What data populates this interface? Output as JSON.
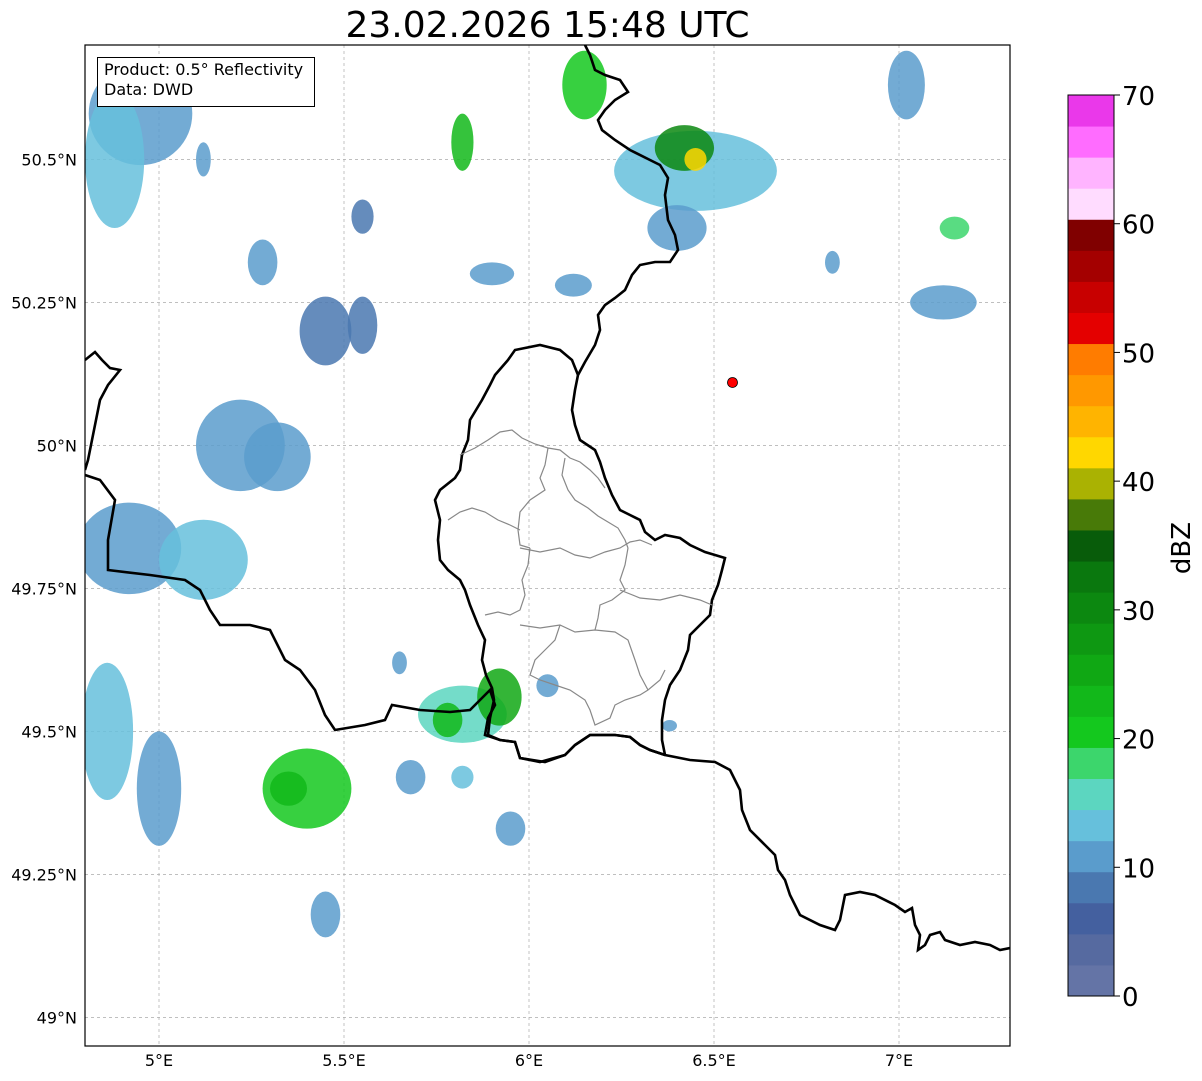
{
  "title": "23.02.2026 15:48 UTC",
  "info": {
    "product": "Product: 0.5° Reflectivity",
    "data": "Data: DWD"
  },
  "map": {
    "extent": {
      "lon": [
        4.8,
        7.3
      ],
      "lat": [
        48.95,
        50.7
      ]
    },
    "lon_ticks": [
      {
        "value": 5.0,
        "label": "5°E"
      },
      {
        "value": 5.5,
        "label": "5.5°E"
      },
      {
        "value": 6.0,
        "label": "6°E"
      },
      {
        "value": 6.5,
        "label": "6.5°E"
      },
      {
        "value": 7.0,
        "label": "7°E"
      }
    ],
    "lat_ticks": [
      {
        "value": 50.5,
        "label": "50.5°N"
      },
      {
        "value": 50.25,
        "label": "50.25°N"
      },
      {
        "value": 50.0,
        "label": "50°N"
      },
      {
        "value": 49.75,
        "label": "49.75°N"
      },
      {
        "value": 49.5,
        "label": "49.5°N"
      },
      {
        "value": 49.25,
        "label": "49.25°N"
      },
      {
        "value": 49.0,
        "label": "49°N"
      }
    ],
    "radar_site": {
      "lon": 6.55,
      "lat": 50.11,
      "color": "#ff0000"
    },
    "echo_cells": [
      {
        "lon": 4.95,
        "lat": 50.58,
        "rlon": 0.14,
        "rlat": 0.09,
        "dbz": 12
      },
      {
        "lon": 4.88,
        "lat": 50.5,
        "rlon": 0.08,
        "rlat": 0.12,
        "dbz": 14
      },
      {
        "lon": 5.22,
        "lat": 50.0,
        "rlon": 0.12,
        "rlat": 0.08,
        "dbz": 10
      },
      {
        "lon": 5.32,
        "lat": 49.98,
        "rlon": 0.09,
        "rlat": 0.06,
        "dbz": 12
      },
      {
        "lon": 5.45,
        "lat": 50.2,
        "rlon": 0.07,
        "rlat": 0.06,
        "dbz": 8
      },
      {
        "lon": 5.55,
        "lat": 50.21,
        "rlon": 0.04,
        "rlat": 0.05,
        "dbz": 8
      },
      {
        "lon": 4.92,
        "lat": 49.82,
        "rlon": 0.14,
        "rlat": 0.08,
        "dbz": 12
      },
      {
        "lon": 5.12,
        "lat": 49.8,
        "rlon": 0.12,
        "rlat": 0.07,
        "dbz": 14
      },
      {
        "lon": 4.86,
        "lat": 49.5,
        "rlon": 0.07,
        "rlat": 0.12,
        "dbz": 14
      },
      {
        "lon": 5.0,
        "lat": 49.4,
        "rlon": 0.06,
        "rlat": 0.1,
        "dbz": 12
      },
      {
        "lon": 5.4,
        "lat": 49.4,
        "rlon": 0.12,
        "rlat": 0.07,
        "dbz": 20
      },
      {
        "lon": 5.35,
        "lat": 49.4,
        "rlon": 0.05,
        "rlat": 0.03,
        "dbz": 24
      },
      {
        "lon": 5.82,
        "lat": 49.53,
        "rlon": 0.12,
        "rlat": 0.05,
        "dbz": 16
      },
      {
        "lon": 5.92,
        "lat": 49.56,
        "rlon": 0.06,
        "rlat": 0.05,
        "dbz": 26
      },
      {
        "lon": 5.78,
        "lat": 49.52,
        "rlon": 0.04,
        "rlat": 0.03,
        "dbz": 22
      },
      {
        "lon": 5.95,
        "lat": 49.33,
        "rlon": 0.04,
        "rlat": 0.03,
        "dbz": 10
      },
      {
        "lon": 5.68,
        "lat": 49.42,
        "rlon": 0.04,
        "rlat": 0.03,
        "dbz": 12
      },
      {
        "lon": 5.82,
        "lat": 49.42,
        "rlon": 0.03,
        "rlat": 0.02,
        "dbz": 14
      },
      {
        "lon": 5.45,
        "lat": 49.18,
        "rlon": 0.04,
        "rlat": 0.04,
        "dbz": 12
      },
      {
        "lon": 5.82,
        "lat": 50.53,
        "rlon": 0.03,
        "rlat": 0.05,
        "dbz": 22
      },
      {
        "lon": 5.9,
        "lat": 50.3,
        "rlon": 0.06,
        "rlat": 0.02,
        "dbz": 10
      },
      {
        "lon": 6.12,
        "lat": 50.28,
        "rlon": 0.05,
        "rlat": 0.02,
        "dbz": 10
      },
      {
        "lon": 6.15,
        "lat": 50.63,
        "rlon": 0.06,
        "rlat": 0.06,
        "dbz": 20
      },
      {
        "lon": 6.45,
        "lat": 50.48,
        "rlon": 0.22,
        "rlat": 0.07,
        "dbz": 14
      },
      {
        "lon": 6.42,
        "lat": 50.52,
        "rlon": 0.08,
        "rlat": 0.04,
        "dbz": 30
      },
      {
        "lon": 6.45,
        "lat": 50.5,
        "rlon": 0.03,
        "rlat": 0.02,
        "dbz": 42
      },
      {
        "lon": 6.4,
        "lat": 50.38,
        "rlon": 0.08,
        "rlat": 0.04,
        "dbz": 10
      },
      {
        "lon": 7.02,
        "lat": 50.63,
        "rlon": 0.05,
        "rlat": 0.06,
        "dbz": 12
      },
      {
        "lon": 7.12,
        "lat": 50.25,
        "rlon": 0.09,
        "rlat": 0.03,
        "dbz": 12
      },
      {
        "lon": 7.15,
        "lat": 50.38,
        "rlon": 0.04,
        "rlat": 0.02,
        "dbz": 18
      },
      {
        "lon": 6.82,
        "lat": 50.32,
        "rlon": 0.02,
        "rlat": 0.02,
        "dbz": 10
      },
      {
        "lon": 5.12,
        "lat": 50.5,
        "rlon": 0.02,
        "rlat": 0.03,
        "dbz": 10
      },
      {
        "lon": 5.28,
        "lat": 50.32,
        "rlon": 0.04,
        "rlat": 0.04,
        "dbz": 10
      },
      {
        "lon": 5.55,
        "lat": 50.4,
        "rlon": 0.03,
        "rlat": 0.03,
        "dbz": 8
      },
      {
        "lon": 5.65,
        "lat": 49.62,
        "rlon": 0.02,
        "rlat": 0.02,
        "dbz": 10
      },
      {
        "lon": 6.05,
        "lat": 49.58,
        "rlon": 0.03,
        "rlat": 0.02,
        "dbz": 12
      },
      {
        "lon": 6.38,
        "lat": 49.51,
        "rlon": 0.02,
        "rlat": 0.01,
        "dbz": 10
      }
    ]
  },
  "colorbar": {
    "label": "dBZ",
    "min": 0,
    "max": 70,
    "ticks": [
      "0",
      "10",
      "20",
      "30",
      "40",
      "50",
      "60",
      "70"
    ],
    "colors": [
      "#6474a6",
      "#566aa0",
      "#44609f",
      "#4a78b0",
      "#5a9ccc",
      "#66c0dc",
      "#5cd6c0",
      "#3cd66c",
      "#14c81e",
      "#12b81a",
      "#10a814",
      "#0e9812",
      "#0c8810",
      "#0a780e",
      "#085c0a",
      "#487a08",
      "#aab202",
      "#ffd700",
      "#ffb400",
      "#ff9800",
      "#ff7c00",
      "#e40000",
      "#c80000",
      "#a40000",
      "#800000",
      "#ffdcff",
      "#ffb4ff",
      "#ff6cff",
      "#ea38ea"
    ]
  }
}
